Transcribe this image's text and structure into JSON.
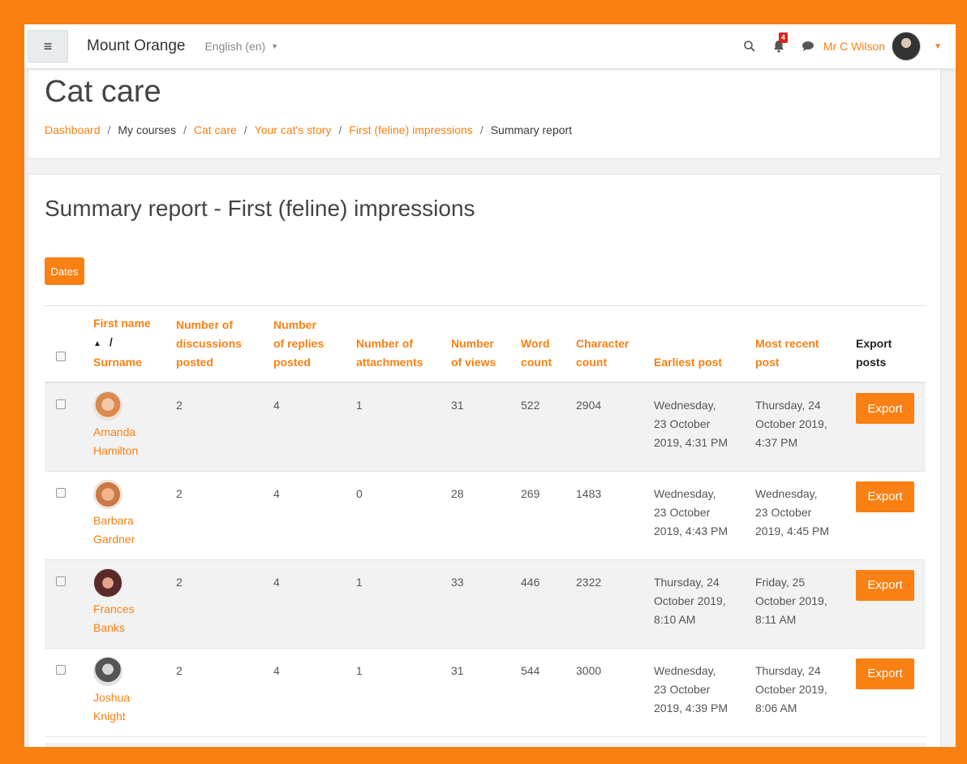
{
  "navbar": {
    "menu_icon": "hamburger-icon",
    "site_name": "Mount Orange",
    "language": "English (en)",
    "notification_count": "4",
    "user_name": "Mr C Wilson",
    "icons": [
      "search-icon",
      "bell-icon",
      "chat-icon",
      "chevron-down-icon"
    ]
  },
  "header": {
    "course_title": "Cat care",
    "breadcrumb": [
      {
        "label": "Dashboard",
        "link": true
      },
      {
        "label": "My courses",
        "link": false
      },
      {
        "label": "Cat care",
        "link": true
      },
      {
        "label": "Your cat's story",
        "link": true
      },
      {
        "label": "First (feline) impressions",
        "link": true
      },
      {
        "label": "Summary report",
        "link": false
      }
    ]
  },
  "report": {
    "title": "Summary report - First (feline) impressions",
    "dates_button": "Dates",
    "columns": {
      "first_name": "First name",
      "surname": "Surname",
      "discussions": [
        "Number of",
        "discussions",
        "posted"
      ],
      "replies": [
        "Number",
        "of replies",
        "posted"
      ],
      "attachments": [
        "Number of",
        "attachments"
      ],
      "views": [
        "Number",
        "of views"
      ],
      "words": [
        "Word",
        "count"
      ],
      "chars": [
        "Character",
        "count"
      ],
      "earliest": "Earliest post",
      "recent": [
        "Most recent",
        "post"
      ],
      "export": [
        "Export",
        "posts"
      ]
    },
    "export_label": "Export",
    "rows": [
      {
        "first": "Amanda",
        "last": "Hamilton",
        "discussions": "2",
        "replies": "4",
        "attachments": "1",
        "views": "31",
        "words": "522",
        "chars": "2904",
        "earliest": [
          "Wednesday,",
          "23 October",
          "2019, 4:31 PM"
        ],
        "recent": [
          "Thursday, 24",
          "October 2019,",
          "4:37 PM"
        ]
      },
      {
        "first": "Barbara",
        "last": "Gardner",
        "discussions": "2",
        "replies": "4",
        "attachments": "0",
        "views": "28",
        "words": "269",
        "chars": "1483",
        "earliest": [
          "Wednesday,",
          "23 October",
          "2019, 4:43 PM"
        ],
        "recent": [
          "Wednesday,",
          "23 October",
          "2019, 4:45 PM"
        ]
      },
      {
        "first": "Frances",
        "last": "Banks",
        "discussions": "2",
        "replies": "4",
        "attachments": "1",
        "views": "33",
        "words": "446",
        "chars": "2322",
        "earliest": [
          "Thursday, 24",
          "October 2019,",
          "8:10 AM"
        ],
        "recent": [
          "Friday, 25",
          "October 2019,",
          "8:11 AM"
        ]
      },
      {
        "first": "Joshua",
        "last": "Knight",
        "discussions": "2",
        "replies": "4",
        "attachments": "1",
        "views": "31",
        "words": "544",
        "chars": "3000",
        "earliest": [
          "Wednesday,",
          "23 October",
          "2019, 4:39 PM"
        ],
        "recent": [
          "Thursday, 24",
          "October 2019,",
          "8:06 AM"
        ]
      }
    ]
  },
  "colors": {
    "brand": "#f98012",
    "badge": "#d9241e"
  }
}
